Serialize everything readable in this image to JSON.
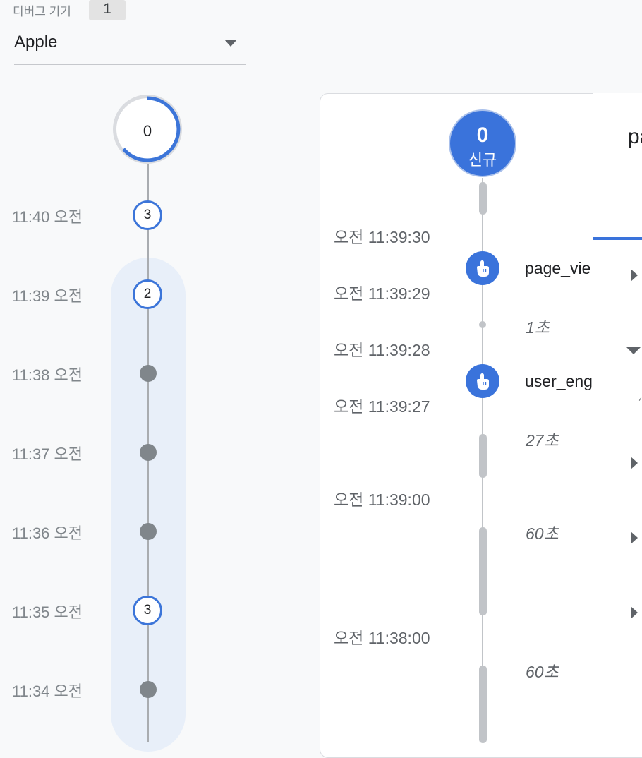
{
  "header": {
    "device_label": "디버그 기기",
    "device_count": "1",
    "device_select": {
      "value": "Apple"
    }
  },
  "minutes": {
    "seconds_counter": "0",
    "rows": [
      {
        "label": "11:40 오전",
        "count": "3"
      },
      {
        "label": "11:39 오전",
        "count": "2"
      },
      {
        "label": "11:38 오전",
        "count": ""
      },
      {
        "label": "11:37 오전",
        "count": ""
      },
      {
        "label": "11:36 오전",
        "count": ""
      },
      {
        "label": "11:35 오전",
        "count": "3"
      },
      {
        "label": "11:34 오전",
        "count": ""
      }
    ]
  },
  "events": {
    "new_users": {
      "count": "0",
      "label": "신규"
    },
    "timestamps": [
      "오전 11:39:30",
      "오전 11:39:29",
      "오전 11:39:28",
      "오전 11:39:27",
      "오전 11:39:00",
      "오전 11:38:00"
    ],
    "items": [
      {
        "name": "page_vie",
        "icon": "touch-icon"
      },
      {
        "name": "user_eng",
        "icon": "touch-icon"
      }
    ],
    "durations": [
      "1초",
      "27초",
      "60초",
      "60초"
    ]
  },
  "detail": {
    "title": "pa"
  },
  "colors": {
    "accent": "#3a73db",
    "band": "#e8eff9",
    "muted": "#80868b"
  }
}
